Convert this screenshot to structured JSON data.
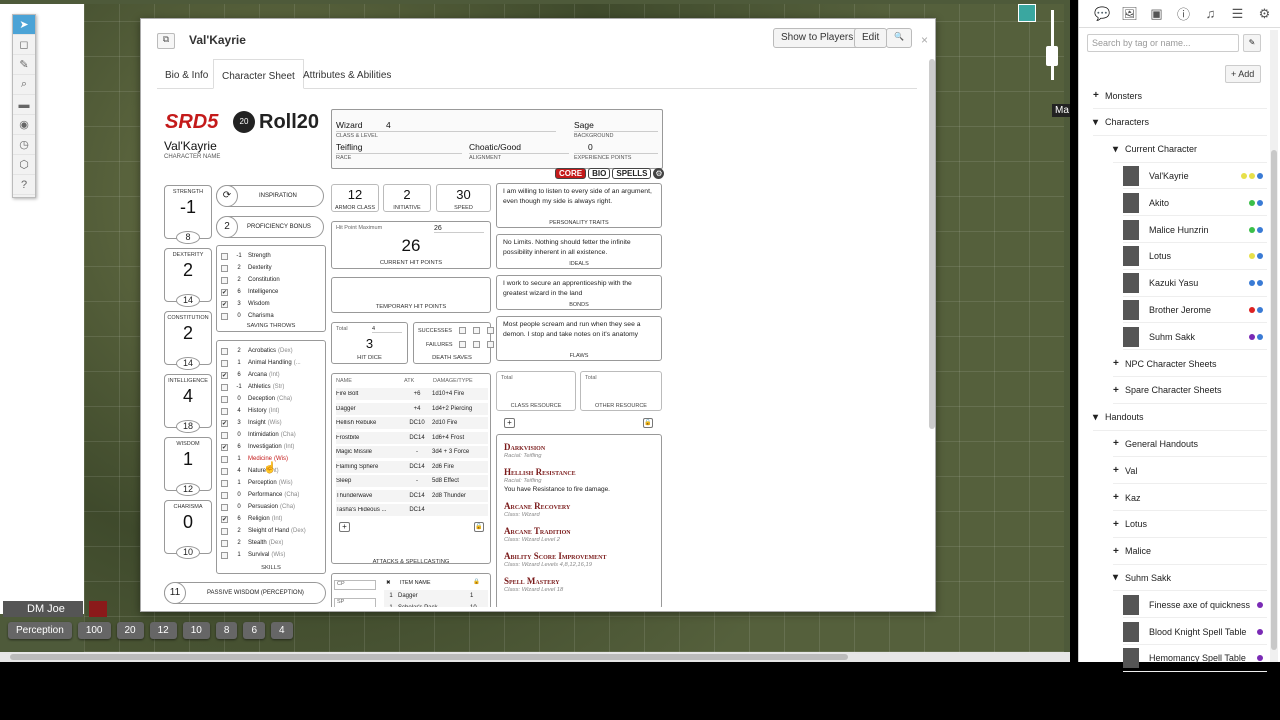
{
  "toolbar": {
    "tools": [
      "select-tool",
      "cube-tool",
      "pencil-tool",
      "zoom-tool",
      "ruler-tool",
      "eye-tool",
      "clock-tool",
      "dice-tool",
      "help-tool"
    ]
  },
  "player": {
    "name": "DM Joe",
    "color": "#8b1a1a"
  },
  "macros": [
    "Perception",
    "100",
    "20",
    "12",
    "10",
    "8",
    "6",
    "4"
  ],
  "map_label": "Ma",
  "dialog": {
    "title": "Val'Kayrie",
    "buttons": {
      "show": "Show to Players",
      "edit": "Edit",
      "search": "🔍",
      "popout": "⧉",
      "close": "×"
    },
    "tabs": [
      "Bio & Info",
      "Character Sheet",
      "Attributes & Abilities"
    ]
  },
  "sheet": {
    "logo": {
      "srd": "SRD5",
      "roll": "Roll20",
      "d20": "20"
    },
    "character_name": "Val'Kayrie",
    "character_name_label": "CHARACTER NAME",
    "header": {
      "class": "Wizard",
      "level": "4",
      "class_label": "CLASS & LEVEL",
      "background": "Sage",
      "background_label": "BACKGROUND",
      "race": "Teifling",
      "race_label": "RACE",
      "alignment": "Choatic/Good",
      "alignment_label": "ALIGNMENT",
      "xp": "0",
      "xp_label": "EXPERIENCE POINTS"
    },
    "section_tabs": [
      "CORE",
      "BIO",
      "SPELLS"
    ],
    "abilities": [
      {
        "name": "STRENGTH",
        "mod": "-1",
        "score": "8"
      },
      {
        "name": "DEXTERITY",
        "mod": "2",
        "score": "14"
      },
      {
        "name": "CONSTITUTION",
        "mod": "2",
        "score": "14"
      },
      {
        "name": "INTELLIGENCE",
        "mod": "4",
        "score": "18"
      },
      {
        "name": "WISDOM",
        "mod": "1",
        "score": "12"
      },
      {
        "name": "CHARISMA",
        "mod": "0",
        "score": "10"
      }
    ],
    "inspiration": "INSPIRATION",
    "proficiency": {
      "value": "2",
      "label": "PROFICIENCY BONUS"
    },
    "saving_throws": {
      "label": "SAVING THROWS",
      "items": [
        {
          "v": "-1",
          "n": "Strength",
          "c": false
        },
        {
          "v": "2",
          "n": "Dexterity",
          "c": false
        },
        {
          "v": "2",
          "n": "Constitution",
          "c": false
        },
        {
          "v": "6",
          "n": "Intelligence",
          "c": true
        },
        {
          "v": "3",
          "n": "Wisdom",
          "c": true
        },
        {
          "v": "0",
          "n": "Charisma",
          "c": false
        }
      ]
    },
    "skills": {
      "label": "SKILLS",
      "items": [
        {
          "v": "2",
          "n": "Acrobatics",
          "a": "(Dex)",
          "c": false
        },
        {
          "v": "1",
          "n": "Animal Handling",
          "a": "(...",
          "c": false
        },
        {
          "v": "6",
          "n": "Arcana",
          "a": "(Int)",
          "c": true
        },
        {
          "v": "-1",
          "n": "Athletics",
          "a": "(Str)",
          "c": false
        },
        {
          "v": "0",
          "n": "Deception",
          "a": "(Cha)",
          "c": false
        },
        {
          "v": "4",
          "n": "History",
          "a": "(Int)",
          "c": false
        },
        {
          "v": "3",
          "n": "Insight",
          "a": "(Wis)",
          "c": true
        },
        {
          "v": "0",
          "n": "Intimidation",
          "a": "(Cha)",
          "c": false
        },
        {
          "v": "6",
          "n": "Investigation",
          "a": "(Int)",
          "c": true
        },
        {
          "v": "1",
          "n": "Medicine",
          "a": "(Wis)",
          "c": false
        },
        {
          "v": "4",
          "n": "Nature",
          "a": "(Int)",
          "c": false
        },
        {
          "v": "1",
          "n": "Perception",
          "a": "(Wis)",
          "c": false
        },
        {
          "v": "0",
          "n": "Performance",
          "a": "(Cha)",
          "c": false
        },
        {
          "v": "0",
          "n": "Persuasion",
          "a": "(Cha)",
          "c": false
        },
        {
          "v": "6",
          "n": "Religion",
          "a": "(Int)",
          "c": true
        },
        {
          "v": "2",
          "n": "Sleight of Hand",
          "a": "(Dex)",
          "c": false
        },
        {
          "v": "2",
          "n": "Stealth",
          "a": "(Dex)",
          "c": false
        },
        {
          "v": "1",
          "n": "Survival",
          "a": "(Wis)",
          "c": false
        }
      ]
    },
    "passive": {
      "value": "11",
      "label": "PASSIVE WISDOM (PERCEPTION)"
    },
    "combat": {
      "ac": "12",
      "ac_label": "ARMOR CLASS",
      "init": "2",
      "init_label": "INITIATIVE",
      "speed": "30",
      "speed_label": "SPEED",
      "hp_max_label": "Hit Point Maximum",
      "hp_max": "26",
      "hp": "26",
      "hp_label": "CURRENT HIT POINTS",
      "temp_label": "TEMPORARY HIT POINTS",
      "hd_total_label": "Total",
      "hd_total": "4",
      "hd": "3",
      "hd_label": "HIT DICE",
      "successes": "SUCCESSES",
      "failures": "FAILURES",
      "death_label": "DEATH SAVES"
    },
    "attacks": {
      "headers": [
        "NAME",
        "ATK",
        "DAMAGE/TYPE"
      ],
      "label": "ATTACKS & SPELLCASTING",
      "rows": [
        [
          "Fire Bolt",
          "+6",
          "1d10+4 Fire"
        ],
        [
          "Dagger",
          "+4",
          "1d4+2 Piercing"
        ],
        [
          "Hellish Rebuke",
          "DC10",
          "2d10 Fire"
        ],
        [
          "Frostbite",
          "DC14",
          "1d6+4 Frost"
        ],
        [
          "Magic Missile",
          "-",
          "3d4 + 3 Force"
        ],
        [
          "Flaming Sphere",
          "DC14",
          "2d6 Fire"
        ],
        [
          "Sleep",
          "-",
          "5d8 Effect"
        ],
        [
          "Thunderwave",
          "DC14",
          "2d8 Thunder"
        ],
        [
          "Tasha's Hideous ...",
          "DC14",
          ""
        ]
      ]
    },
    "equipment": {
      "cp": "CP",
      "sp": "SP",
      "item_header": "ITEM NAME",
      "rows": [
        [
          "1",
          "Dagger",
          "1"
        ],
        [
          "1",
          "Scholar's Pack",
          "10"
        ]
      ]
    },
    "traits": [
      {
        "text": "I am willing to listen to every side of an argument, even though my side is always right.",
        "label": "PERSONALITY TRAITS"
      },
      {
        "text": "No Limits. Nothing should fetter the infinite possibility inherent in all existence.",
        "label": "IDEALS"
      },
      {
        "text": "I work to secure an apprenticeship with the greatest wizard in the land",
        "label": "BONDS"
      },
      {
        "text": "Most people scream and run when they see a demon. I stop and take notes on it's anatomy",
        "label": "FLAWS"
      }
    ],
    "resources": {
      "total": "Total",
      "class": "CLASS RESOURCE",
      "other": "OTHER RESOURCE"
    },
    "features": [
      {
        "title": "Darkvision",
        "sub": "Racial: Teifling",
        "desc": ""
      },
      {
        "title": "Hellish Resistance",
        "sub": "Racial: Teifling",
        "desc": "You have Resistance to fire damage."
      },
      {
        "title": "Arcane Recovery",
        "sub": "Class: Wizard",
        "desc": ""
      },
      {
        "title": "Arcane Tradition",
        "sub": "Class: Wizard Level 2",
        "desc": ""
      },
      {
        "title": "Ability Score Improvement",
        "sub": "Class: Wizard Levels 4,8,12,16,19",
        "desc": ""
      },
      {
        "title": "Spell Mastery",
        "sub": "Class: Wizard Level 18",
        "desc": ""
      }
    ]
  },
  "right": {
    "search_placeholder": "Search by tag or name...",
    "add": "+ Add",
    "tree": [
      {
        "label": "Monsters",
        "level": 0,
        "pm": "+"
      },
      {
        "label": "Characters",
        "level": 0,
        "pm": "-"
      },
      {
        "label": "Current Character",
        "level": 1,
        "pm": "-"
      },
      {
        "label": "Val'Kayrie",
        "level": 2,
        "avatar": true,
        "dots": [
          "#e7e04a",
          "#e7e04a",
          "#3a7bd5"
        ]
      },
      {
        "label": "Akito",
        "level": 2,
        "avatar": true,
        "dots": [
          "#3bbf4a",
          "#3a7bd5"
        ]
      },
      {
        "label": "Malice Hunzrin",
        "level": 2,
        "avatar": true,
        "dots": [
          "#3bbf4a",
          "#3a7bd5"
        ]
      },
      {
        "label": "Lotus",
        "level": 2,
        "avatar": true,
        "dots": [
          "#e7e04a",
          "#3a7bd5"
        ]
      },
      {
        "label": "Kazuki Yasu",
        "level": 2,
        "avatar": true,
        "dots": [
          "#3a7bd5",
          "#3a7bd5"
        ]
      },
      {
        "label": "Brother Jerome",
        "level": 2,
        "avatar": true,
        "dots": [
          "#d22",
          "#3a7bd5"
        ]
      },
      {
        "label": "Suhm Sakk",
        "level": 2,
        "avatar": true,
        "dots": [
          "#7a2ab5",
          "#3a7bd5"
        ]
      },
      {
        "label": "NPC Character Sheets",
        "level": 1,
        "pm": "+"
      },
      {
        "label": "Spare Character Sheets",
        "level": 1,
        "pm": "+"
      },
      {
        "label": "Handouts",
        "level": 0,
        "pm": "-"
      },
      {
        "label": "General Handouts",
        "level": 1,
        "pm": "+"
      },
      {
        "label": "Val",
        "level": 1,
        "pm": "+"
      },
      {
        "label": "Kaz",
        "level": 1,
        "pm": "+"
      },
      {
        "label": "Lotus",
        "level": 1,
        "pm": "+"
      },
      {
        "label": "Malice",
        "level": 1,
        "pm": "+"
      },
      {
        "label": "Suhm Sakk",
        "level": 1,
        "pm": "-"
      },
      {
        "label": "Finesse axe of quickness",
        "level": 2,
        "avatar": true,
        "dots": [
          "#7a2ab5"
        ]
      },
      {
        "label": "Blood Knight Spell Table",
        "level": 2,
        "avatar": true,
        "dots": [
          "#7a2ab5"
        ]
      },
      {
        "label": "Hemomancy Spell Table",
        "level": 2,
        "avatar": true,
        "dots": [
          "#7a2ab5"
        ]
      }
    ]
  }
}
